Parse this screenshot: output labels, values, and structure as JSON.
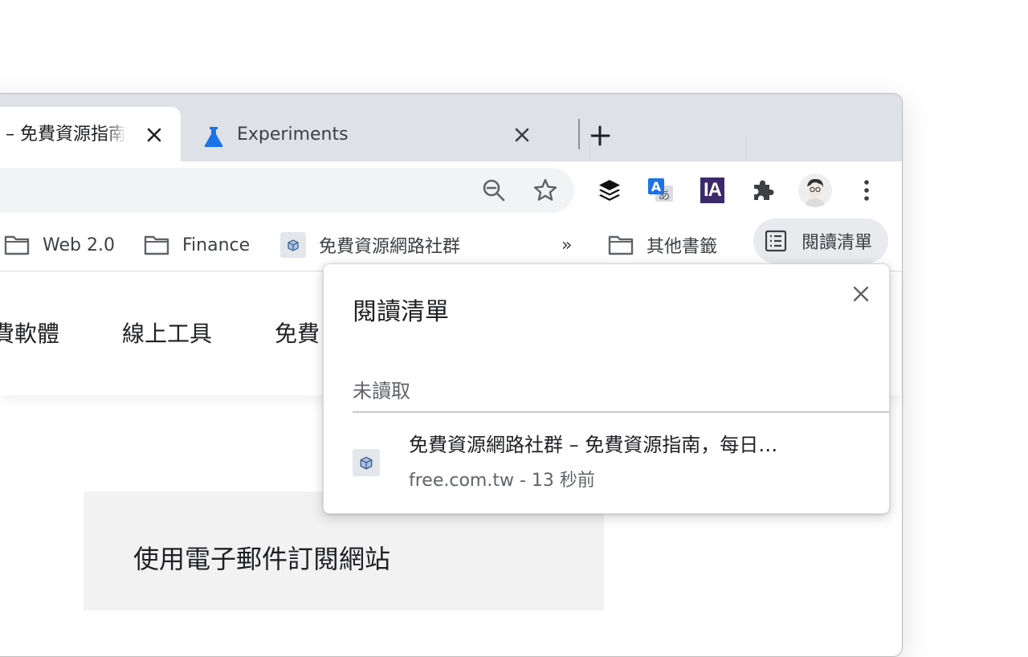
{
  "tabs": [
    {
      "title": "免費資源網路社群 – 免費資源指南",
      "active": true
    },
    {
      "title": "Experiments",
      "active": false
    }
  ],
  "bookmarks": [
    {
      "label": "Web 2.0",
      "icon": "folder-icon"
    },
    {
      "label": "Finance",
      "icon": "folder-icon"
    },
    {
      "label": "免費資源網路社群",
      "icon": "site-favicon"
    },
    {
      "label": "其他書籤",
      "icon": "folder-icon"
    }
  ],
  "bookmarks_overflow": "»",
  "reading_list_button": "閱讀清單",
  "page": {
    "nav": [
      "費軟體",
      "線上工具",
      "免費"
    ],
    "subscribe_title": "使用電子郵件訂閱網站"
  },
  "reading_list_popup": {
    "title": "閱讀清單",
    "section": "未讀取",
    "items": [
      {
        "title": "免費資源網路社群 – 免費資源指南，每日…",
        "subtitle": "free.com.tw - 13 秒前"
      }
    ]
  },
  "colors": {
    "tab_strip": "#dee1e6",
    "omnibox": "#f1f3f4",
    "experiments_icon": "#1a73e8",
    "ia_badge": "#3a2a6b"
  }
}
